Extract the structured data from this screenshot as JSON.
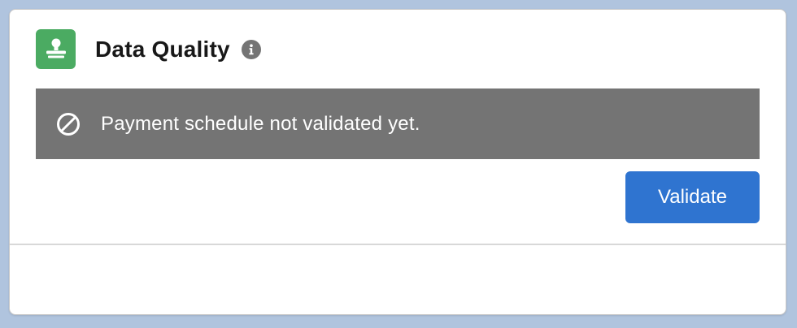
{
  "card": {
    "title": "Data Quality",
    "app_icon": "stamp-icon",
    "info_icon": "info-icon"
  },
  "banner": {
    "icon": "ban-icon",
    "message": "Payment schedule not validated yet."
  },
  "actions": {
    "validate_label": "Validate"
  },
  "colors": {
    "page_background": "#b0c4de",
    "app_icon_background": "#4bab62",
    "banner_background": "#747474",
    "button_background": "#2f74d0",
    "info_icon_background": "#747474"
  }
}
